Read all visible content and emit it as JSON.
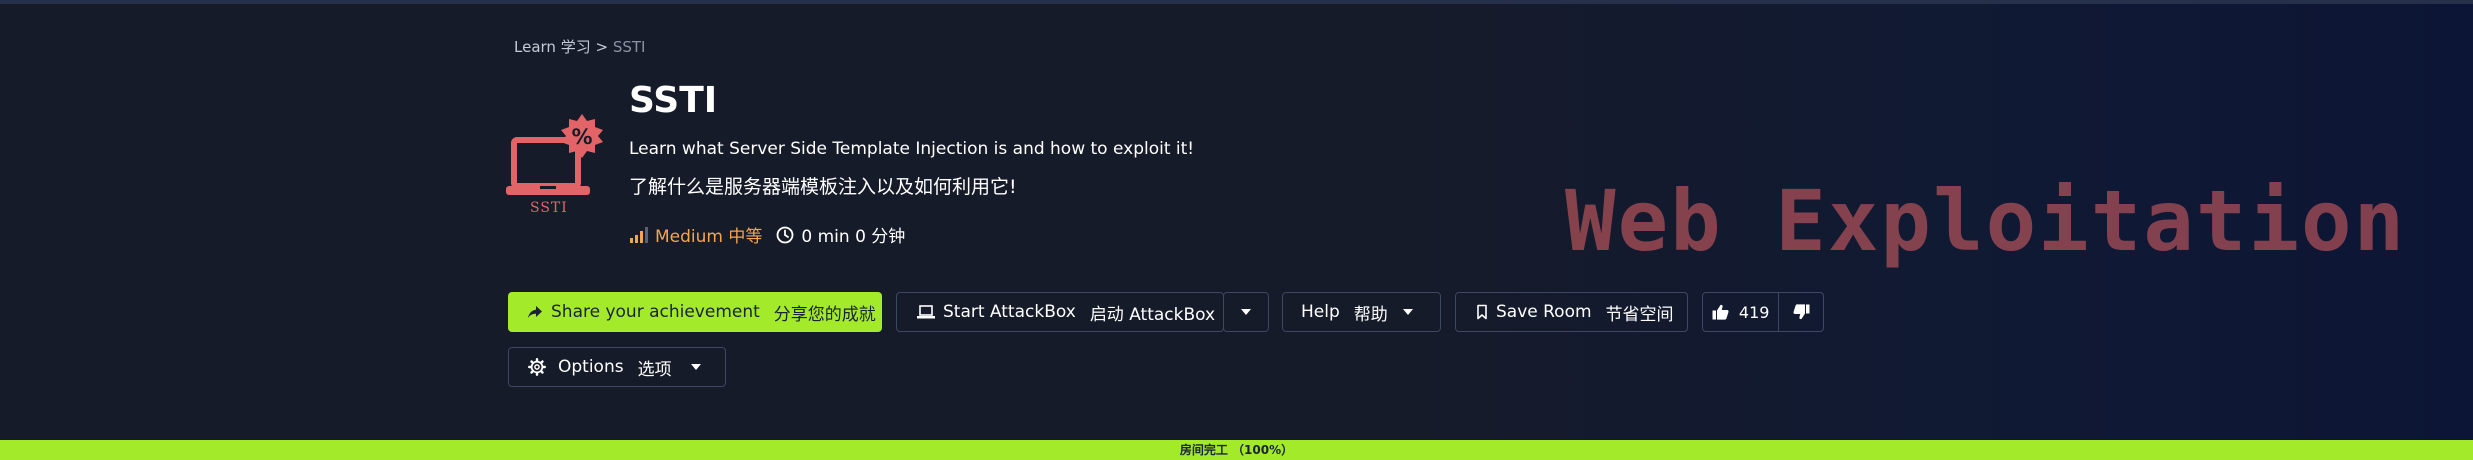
{
  "breadcrumb": {
    "learn": "Learn 学习",
    "separator": ">",
    "current": "SSTI"
  },
  "room": {
    "logo_text": "SSTI",
    "title": "SSTI",
    "description_en": "Learn what Server Side Template Injection is and how to exploit it!",
    "description_zh": "了解什么是服务器端模板注入以及如何利用它!",
    "difficulty": "Medium 中等",
    "duration": "0 min 0 分钟",
    "category_banner": "Web Exploitation"
  },
  "buttons": {
    "share_en": "Share your achievement",
    "share_zh": "分享您的成就",
    "attackbox_en": "Start AttackBox",
    "attackbox_zh": "启动 AttackBox",
    "help_en": "Help",
    "help_zh": "帮助",
    "save_en": "Save Room",
    "save_zh": "节省空间",
    "upvotes": "419",
    "options_en": "Options",
    "options_zh": "选项"
  },
  "progress": {
    "label": "房间完工 （100%）",
    "percent": 100
  },
  "colors": {
    "accent_green": "#a3ea2a",
    "logo_red": "#e36466",
    "difficulty_orange": "#f6a54c",
    "background": "#161b29"
  },
  "icons": [
    "logo-laptop-percent-icon",
    "signal-bars-icon",
    "clock-icon",
    "share-icon",
    "laptop-icon",
    "chevron-down-icon",
    "bookmark-icon",
    "thumbs-up-icon",
    "thumbs-down-icon",
    "gear-icon"
  ]
}
